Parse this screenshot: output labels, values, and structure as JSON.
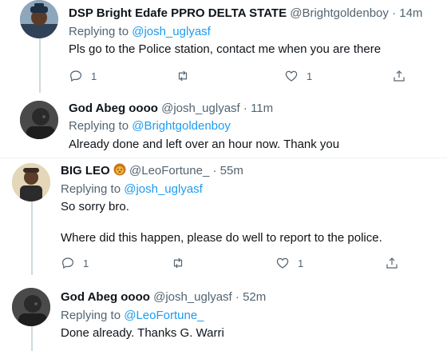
{
  "tweets": [
    {
      "name": "DSP Bright Edafe PPRO DELTA STATE",
      "handle": "@Brightgoldenboy",
      "sep": "·",
      "time": "14m",
      "replying_prefix": "Replying to",
      "replying_to": "@josh_uglyasf",
      "lines": [
        "Pls go to the Police station,  contact me when you are there"
      ],
      "reply_count": "1",
      "retweet_count": "",
      "like_count": "1"
    },
    {
      "name": "God Abeg oooo",
      "handle": "@josh_uglyasf",
      "sep": "·",
      "time": "11m",
      "replying_prefix": "Replying to",
      "replying_to": "@Brightgoldenboy",
      "lines": [
        "Already done and left over an hour now. Thank you"
      ]
    },
    {
      "name": "BIG LEO",
      "name_emoji": "lion-face-emoji",
      "handle": "@LeoFortune_",
      "sep": "·",
      "time": "55m",
      "replying_prefix": "Replying to",
      "replying_to": "@josh_uglyasf",
      "lines": [
        "So sorry bro.",
        "Where did this happen, please do well to report to the police."
      ],
      "reply_count": "1",
      "retweet_count": "",
      "like_count": "1"
    },
    {
      "name": "God Abeg oooo",
      "handle": "@josh_uglyasf",
      "sep": "·",
      "time": "52m",
      "replying_prefix": "Replying to",
      "replying_to": "@LeoFortune_",
      "lines": [
        "Done already. Thanks G. Warri"
      ]
    }
  ],
  "colors": {
    "link": "#1d9bf0",
    "muted": "#536471",
    "thread_line": "#cfd9de"
  }
}
